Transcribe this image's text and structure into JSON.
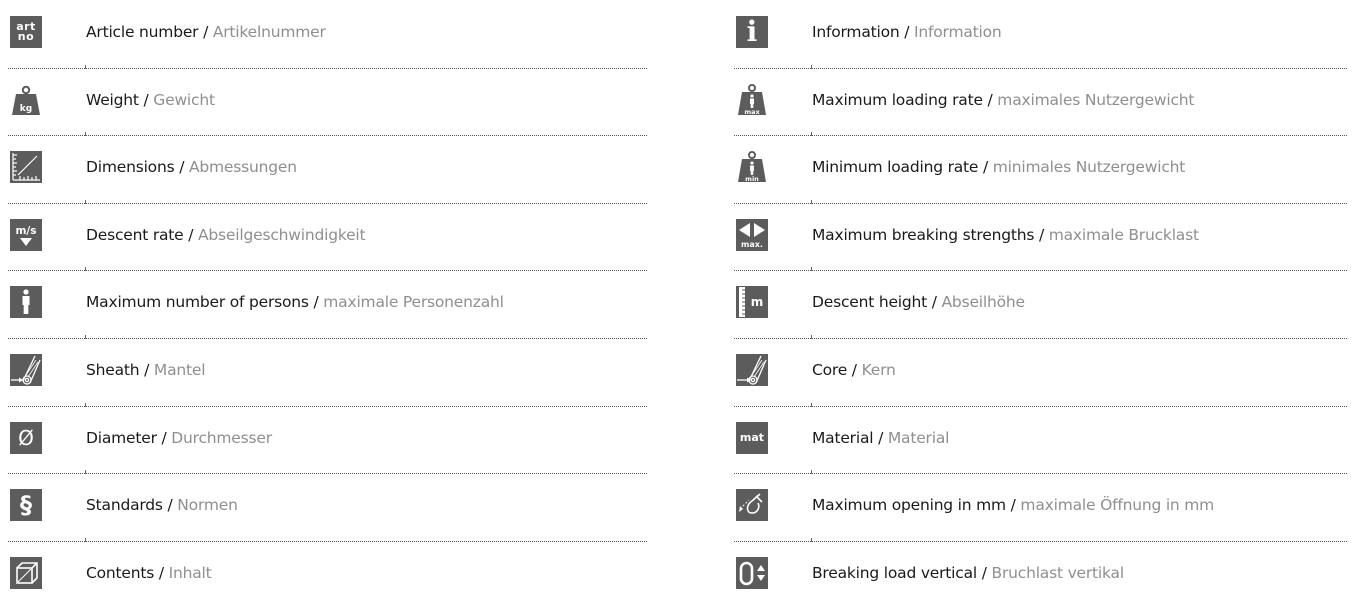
{
  "separator": " / ",
  "left_items": [
    {
      "icon": "article-number-icon",
      "icon_text": [
        "art",
        "no"
      ],
      "en": "Article number",
      "de": "Artikelnummer"
    },
    {
      "icon": "weight-icon",
      "icon_text": [
        "kg"
      ],
      "en": "Weight",
      "de": "Gewicht"
    },
    {
      "icon": "dimensions-icon",
      "en": "Dimensions",
      "de": "Abmessungen"
    },
    {
      "icon": "descent-rate-icon",
      "icon_text": [
        "m/s"
      ],
      "en": "Descent rate",
      "de": "Abseilgeschwindigkeit"
    },
    {
      "icon": "person-icon",
      "en": "Maximum number of persons",
      "de": "maximale Personenzahl"
    },
    {
      "icon": "sheath-icon",
      "en": "Sheath",
      "de": "Mantel"
    },
    {
      "icon": "diameter-icon",
      "icon_text": [
        "Ø"
      ],
      "en": "Diameter",
      "de": "Durchmesser"
    },
    {
      "icon": "standards-icon",
      "icon_text": [
        "§"
      ],
      "en": "Standards",
      "de": "Normen"
    },
    {
      "icon": "contents-icon",
      "en": "Contents",
      "de": "Inhalt"
    }
  ],
  "right_items": [
    {
      "icon": "information-icon",
      "icon_text": [
        "i"
      ],
      "en": "Information",
      "de": "Information"
    },
    {
      "icon": "max-loading-icon",
      "icon_text": [
        "max"
      ],
      "en": "Maximum loading rate",
      "de": "maximales Nutzergewicht"
    },
    {
      "icon": "min-loading-icon",
      "icon_text": [
        "min"
      ],
      "en": "Minimum loading rate",
      "de": "minimales Nutzergewicht"
    },
    {
      "icon": "breaking-strength-icon",
      "icon_text": [
        "max."
      ],
      "en": "Maximum breaking strengths",
      "de": "maximale Brucklast"
    },
    {
      "icon": "descent-height-icon",
      "icon_text": [
        "m"
      ],
      "en": "Descent height",
      "de": "Abseilhöhe"
    },
    {
      "icon": "core-icon",
      "en": "Core",
      "de": "Kern"
    },
    {
      "icon": "material-icon",
      "icon_text": [
        "mat"
      ],
      "en": "Material",
      "de": "Material"
    },
    {
      "icon": "opening-icon",
      "en": "Maximum opening in mm",
      "de": "maximale Öffnung in mm"
    },
    {
      "icon": "breaking-load-vertical-icon",
      "en": "Breaking load vertical",
      "de": "Bruchlast vertikal"
    }
  ],
  "colors": {
    "icon_bg": "#5c5c5c",
    "english_text": "#1a1a1a",
    "german_text": "#8f8f8f",
    "divider": "#555555"
  }
}
